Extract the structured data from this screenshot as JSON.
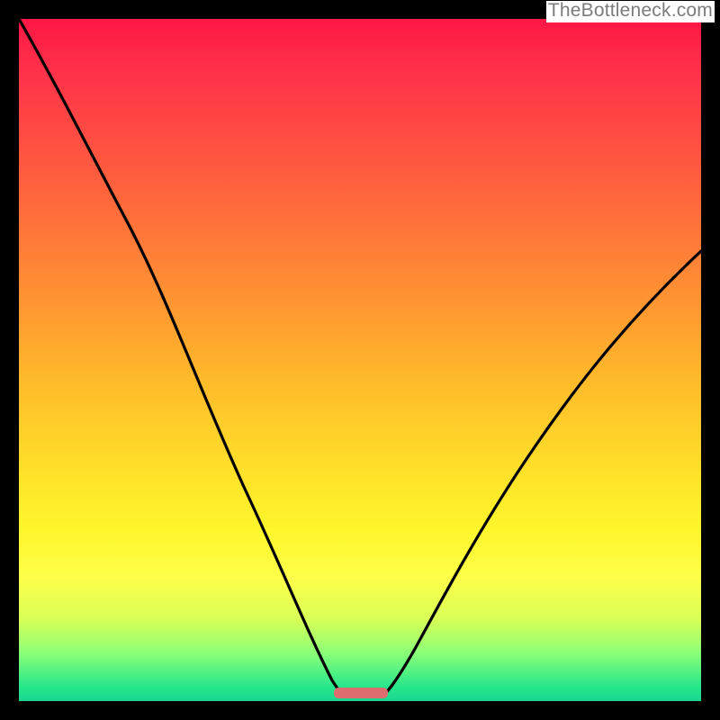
{
  "attribution": "TheBottleneck.com",
  "chart_data": {
    "type": "line",
    "title": "",
    "xlabel": "",
    "ylabel": "",
    "xlim": [
      0,
      100
    ],
    "ylim": [
      0,
      100
    ],
    "series": [
      {
        "name": "left-curve",
        "x": [
          0,
          6,
          12,
          19,
          25,
          31,
          37,
          42,
          45.5,
          47.5
        ],
        "y": [
          100,
          88,
          77,
          66,
          52,
          37,
          22,
          10,
          2,
          0
        ]
      },
      {
        "name": "right-curve",
        "x": [
          53,
          56,
          60,
          65,
          71,
          78,
          85,
          92,
          100
        ],
        "y": [
          0,
          3,
          9,
          17,
          27,
          38,
          48,
          57,
          66
        ]
      }
    ],
    "marker": {
      "name": "bottleneck-region",
      "x": [
        46,
        54
      ],
      "y": 0,
      "color": "#dd6d6f"
    },
    "gradient_stops": [
      {
        "pos": 0.0,
        "color": "#ff1744"
      },
      {
        "pos": 0.25,
        "color": "#ff7a38"
      },
      {
        "pos": 0.55,
        "color": "#ffd429"
      },
      {
        "pos": 0.8,
        "color": "#fdff4a"
      },
      {
        "pos": 1.0,
        "color": "#1ad691"
      }
    ]
  }
}
